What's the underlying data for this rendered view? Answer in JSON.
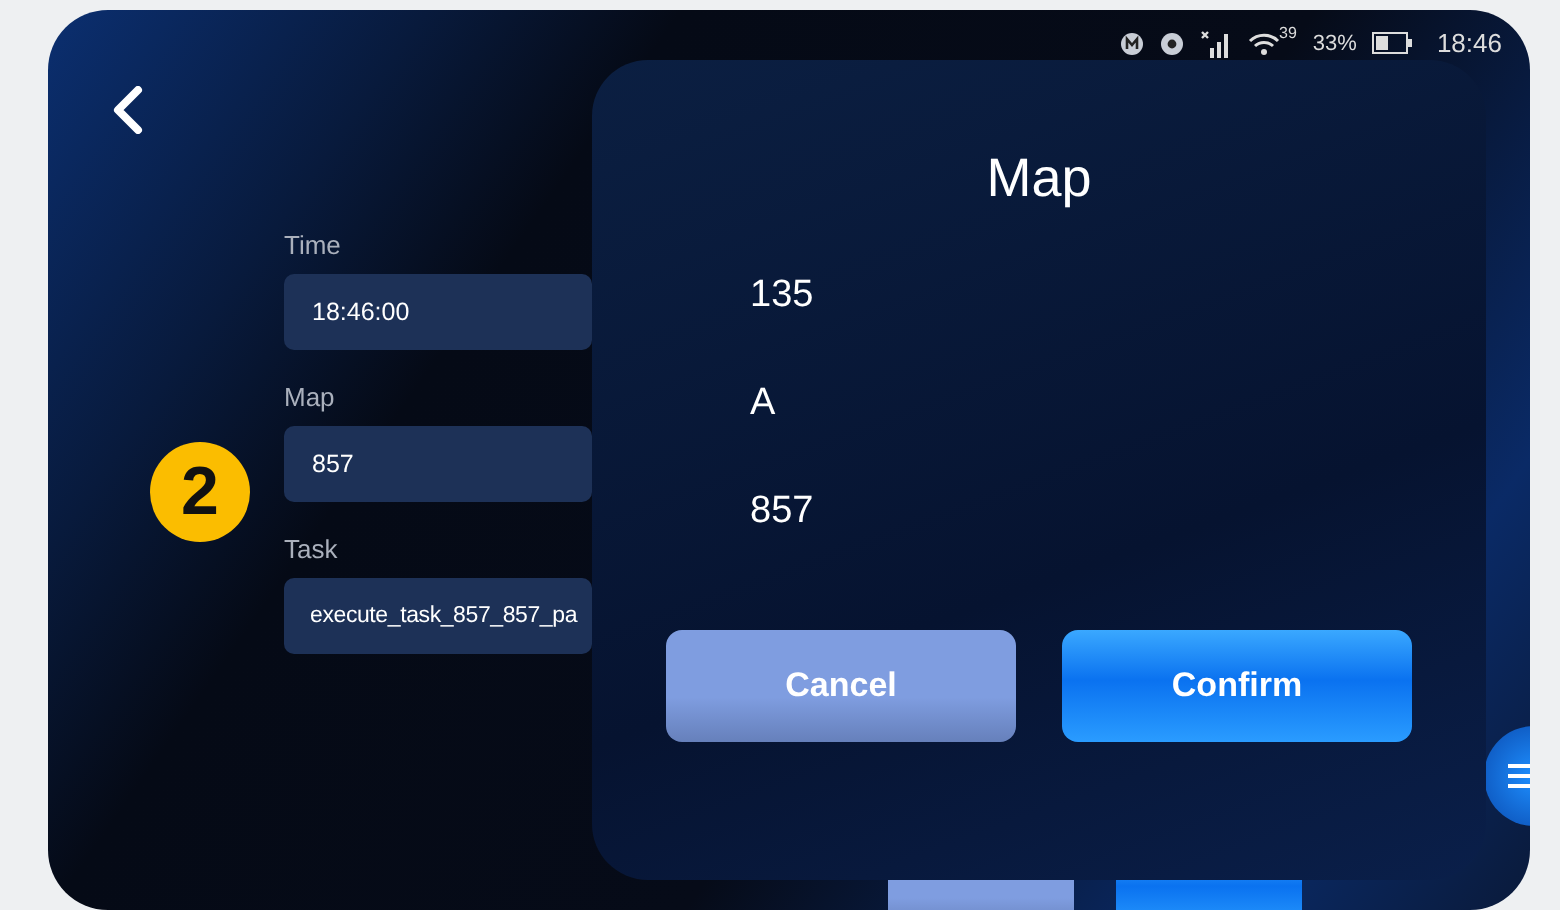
{
  "status_bar": {
    "wifi_speed": "39",
    "battery": "33%",
    "time": "18:46"
  },
  "form": {
    "fields": [
      {
        "label": "Time",
        "value": "18:46:00"
      },
      {
        "label": "Map",
        "value": "857"
      },
      {
        "label": "Task",
        "value": "execute_task_857_857_pa"
      }
    ]
  },
  "annotation": {
    "badge": "2"
  },
  "footer_buttons": [
    {
      "kind": "secondary"
    },
    {
      "kind": "primary"
    }
  ],
  "dialog": {
    "title": "Map",
    "options": [
      "135",
      "A",
      "857"
    ],
    "buttons": [
      {
        "label": "Cancel",
        "kind": "secondary"
      },
      {
        "label": "Confirm",
        "kind": "primary"
      }
    ]
  }
}
